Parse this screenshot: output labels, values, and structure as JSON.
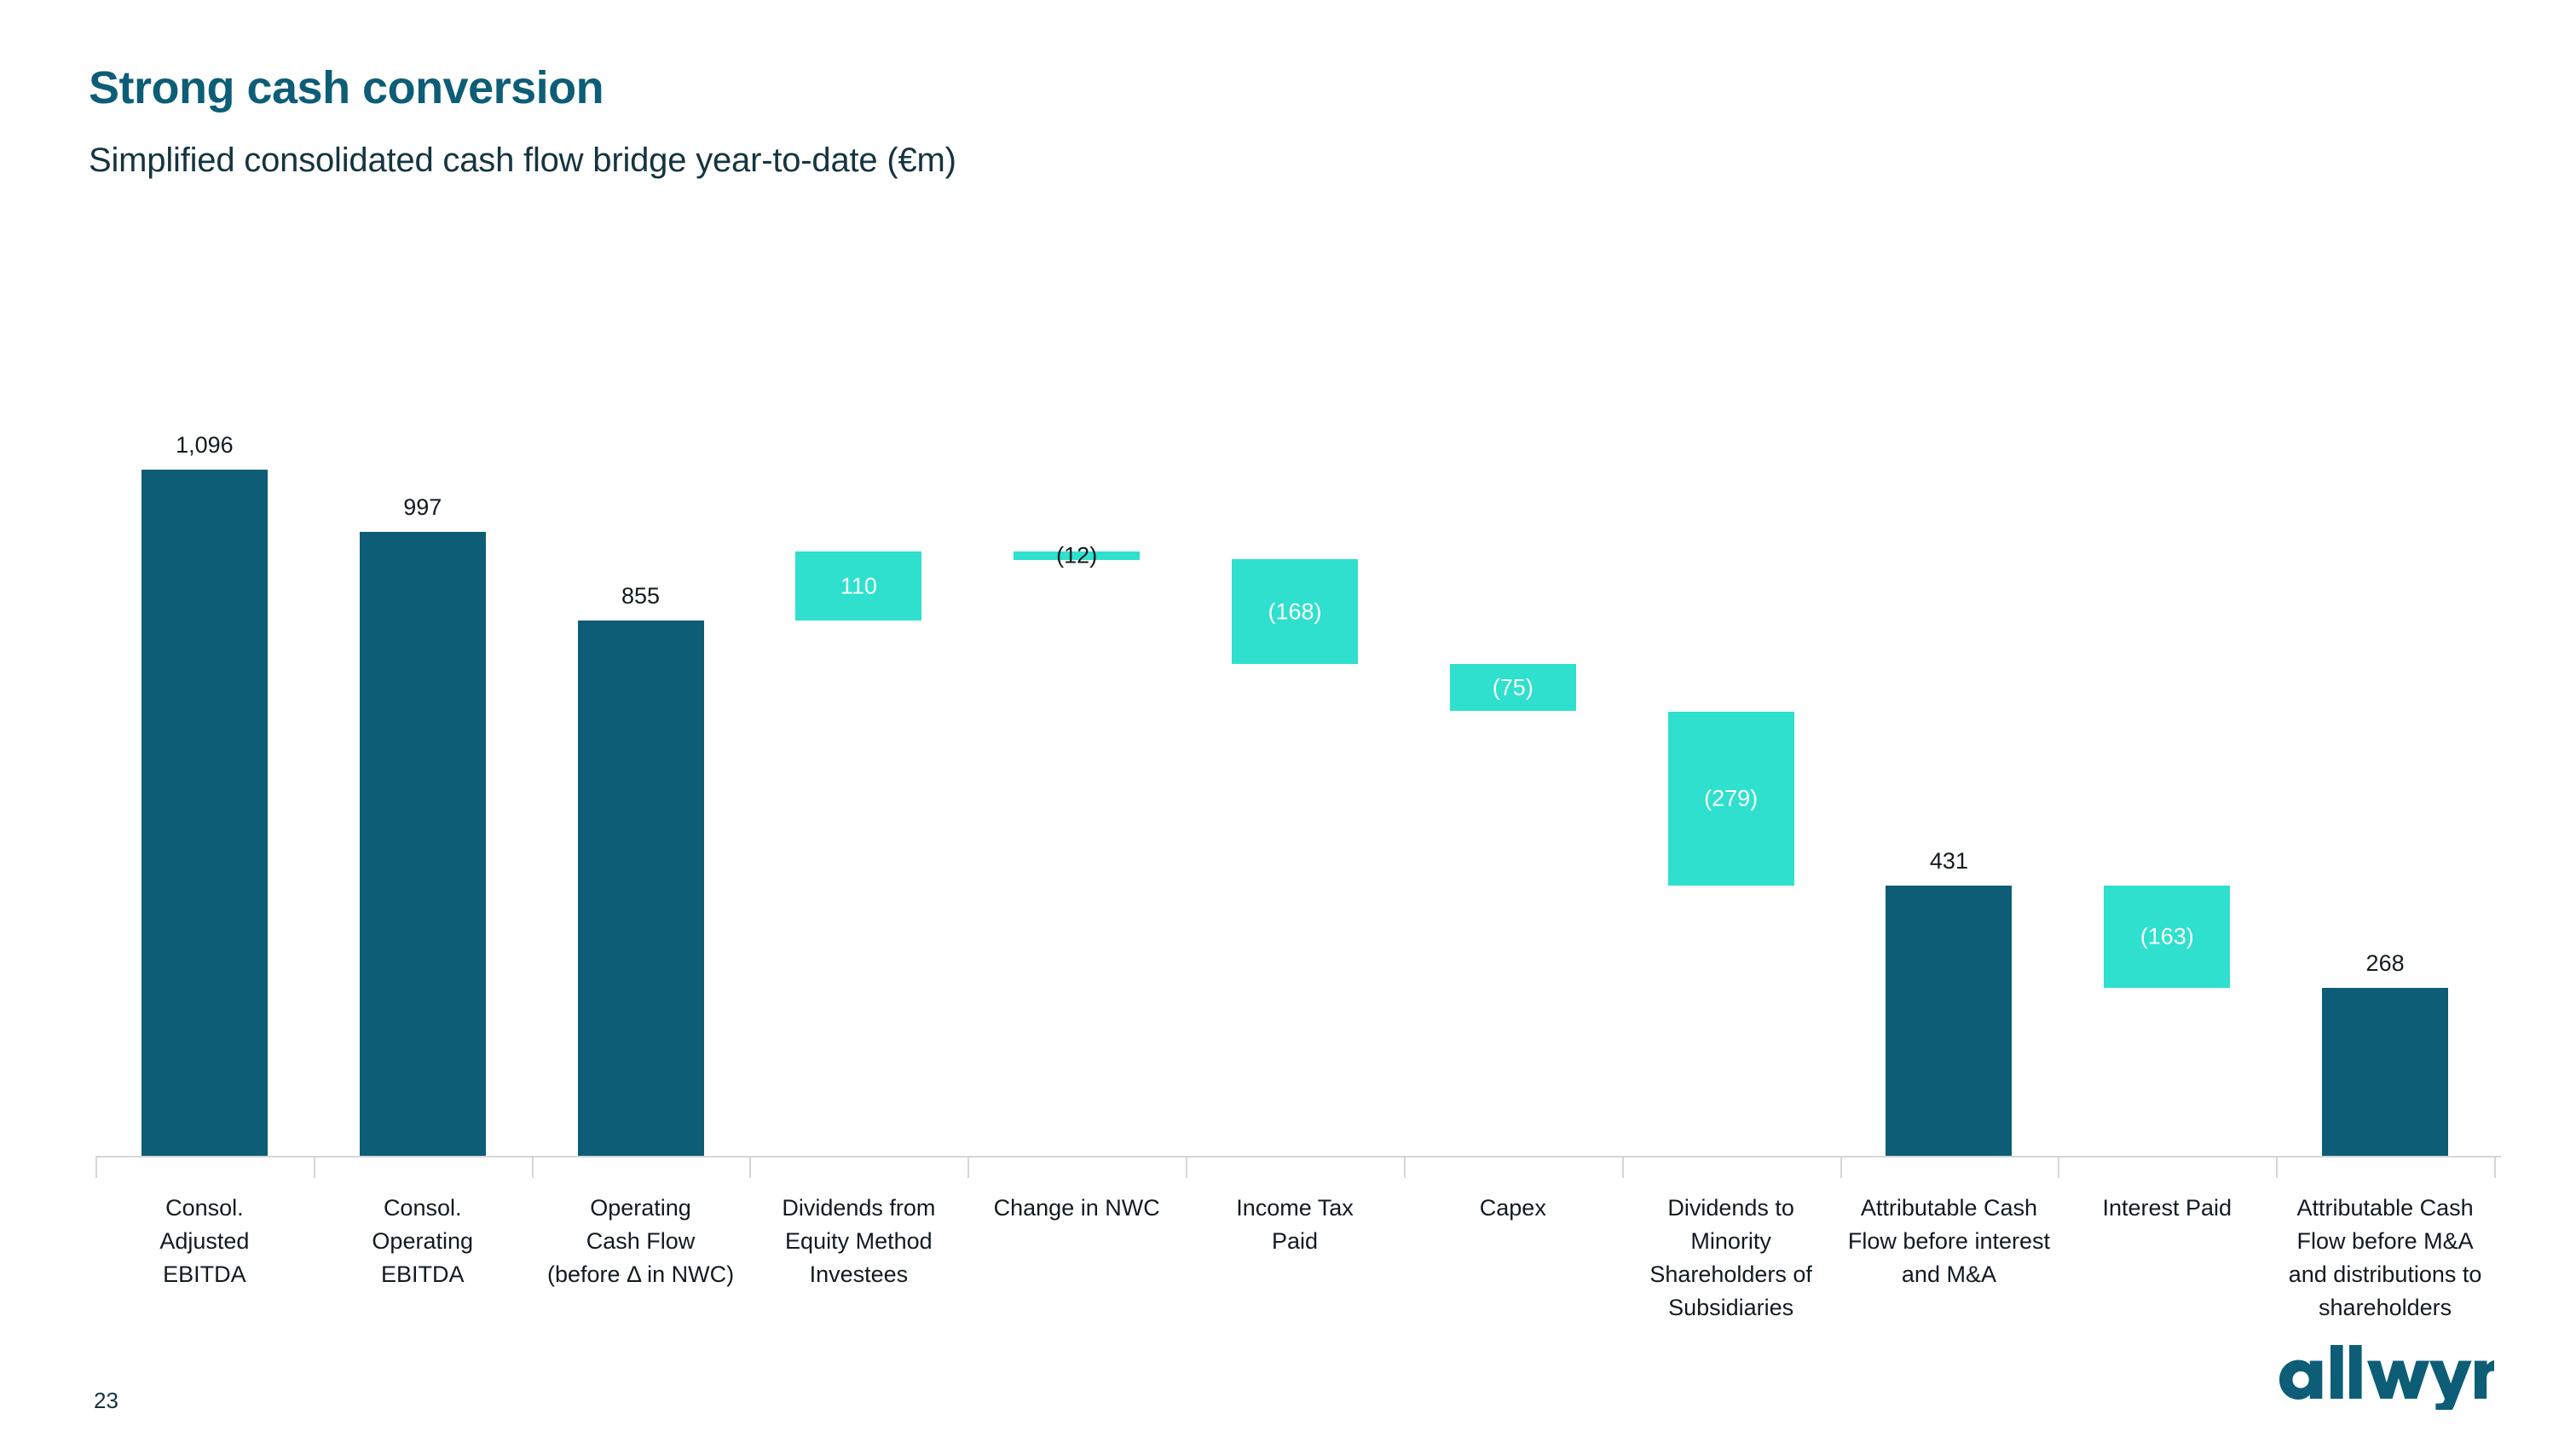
{
  "header": {
    "title": "Strong cash conversion",
    "subtitle": "Simplified consolidated cash flow bridge year-to-date (€m)"
  },
  "footer": {
    "page_number": "23",
    "logo_text": "allwyn"
  },
  "colors": {
    "brand_dark_teal": "#0d5d77",
    "accent_teal": "#2ee0cd",
    "text_dark": "#111b1f",
    "axis_gray": "#d4d7d9"
  },
  "chart_data": {
    "type": "bar",
    "subtype": "waterfall",
    "title": "Strong cash conversion",
    "subtitle": "Simplified consolidated cash flow bridge year-to-date (€m)",
    "xlabel": "",
    "ylabel": "",
    "unit": "€m",
    "grid": false,
    "legend": "none",
    "ylim": [
      0,
      1180
    ],
    "categories": [
      "Consol. Adjusted EBITDA",
      "Consol. Operating EBITDA",
      "Operating Cash Flow (before Δ in NWC)",
      "Dividends from Equity Method Investees",
      "Change in NWC",
      "Income Tax Paid",
      "Capex",
      "Dividends to Minority Shareholders of Subsidiaries",
      "Attributable Cash Flow before interest and M&A",
      "Interest Paid",
      "Attributable Cash Flow before M&A and distributions to shareholders"
    ],
    "values": [
      1096,
      997,
      855,
      110,
      -12,
      -168,
      -75,
      -279,
      431,
      -163,
      268
    ],
    "labels": [
      "1,096",
      "997",
      "855",
      "110",
      "(12)",
      "(168)",
      "(75)",
      "(279)",
      "431",
      "(163)",
      "268"
    ],
    "bar_kinds": [
      "total",
      "total",
      "total",
      "delta",
      "delta",
      "delta",
      "delta",
      "delta",
      "total",
      "delta",
      "total"
    ],
    "bar_bases": [
      0,
      0,
      0,
      855,
      953,
      785,
      710,
      431,
      0,
      268,
      0
    ],
    "bar_tops": [
      1096,
      997,
      855,
      965,
      965,
      953,
      785,
      710,
      431,
      431,
      268
    ],
    "label_placement": [
      "above",
      "above",
      "above",
      "inside",
      "above-thin",
      "inside",
      "inside",
      "inside",
      "above",
      "inside",
      "above"
    ]
  },
  "bars": [
    {
      "label": "1,096",
      "category_lines": [
        "Consol.",
        "Adjusted",
        "EBITDA"
      ]
    },
    {
      "label": "997",
      "category_lines": [
        "Consol.",
        "Operating",
        "EBITDA"
      ]
    },
    {
      "label": "855",
      "category_lines": [
        "Operating",
        "Cash Flow",
        "(before Δ in NWC)"
      ]
    },
    {
      "label": "110",
      "category_lines": [
        "Dividends from",
        "Equity Method",
        "Investees"
      ]
    },
    {
      "label": "(12)",
      "category_lines": [
        "Change in NWC"
      ]
    },
    {
      "label": "(168)",
      "category_lines": [
        "Income Tax",
        "Paid"
      ]
    },
    {
      "label": "(75)",
      "category_lines": [
        "Capex"
      ]
    },
    {
      "label": "(279)",
      "category_lines": [
        "Dividends to",
        "Minority",
        "Shareholders of",
        "Subsidiaries"
      ]
    },
    {
      "label": "431",
      "category_lines": [
        "Attributable Cash",
        "Flow before interest",
        "and M&A"
      ]
    },
    {
      "label": "(163)",
      "category_lines": [
        "Interest Paid"
      ]
    },
    {
      "label": "268",
      "category_lines": [
        "Attributable Cash",
        "Flow before M&A",
        "and distributions to",
        "shareholders"
      ]
    }
  ]
}
